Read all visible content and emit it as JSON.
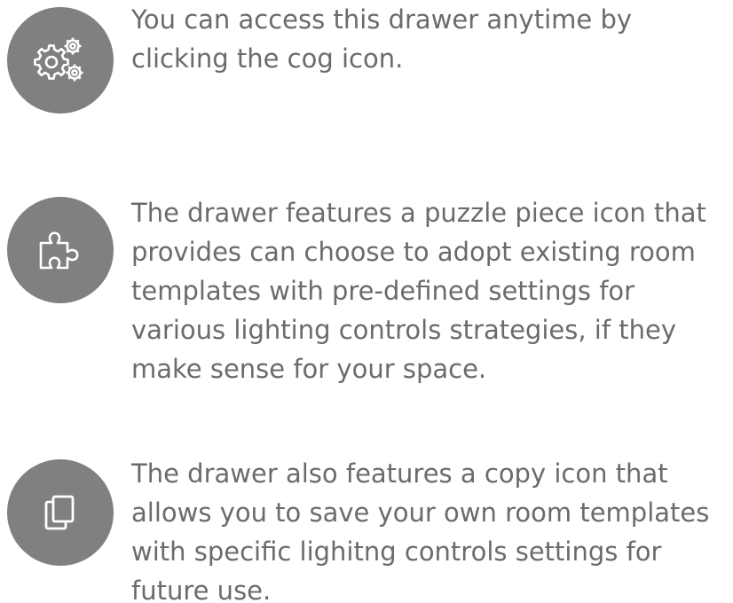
{
  "items": [
    {
      "icon": "cog-icon",
      "text": "You can access this drawer anytime by clicking the cog icon."
    },
    {
      "icon": "puzzle-piece-icon",
      "text": "The drawer features a puzzle piece icon that provides can choose to adopt existing room templates with pre-defined settings for various lighting controls strategies, if they make sense for your space."
    },
    {
      "icon": "copy-icon",
      "text": "The drawer also features a copy icon that allows you to save your own room templates with specific lighitng controls settings for future use."
    }
  ],
  "colors": {
    "circle": "#808080",
    "icon_stroke": "#ffffff",
    "text": "#6b6b6b"
  }
}
